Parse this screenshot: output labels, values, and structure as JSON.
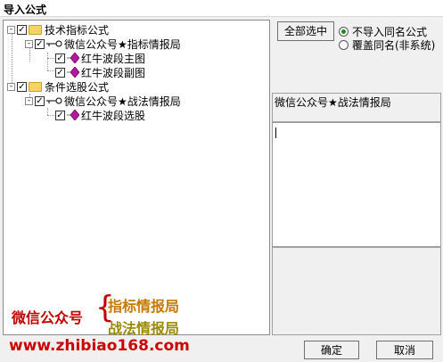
{
  "window": {
    "title": "导入公式"
  },
  "tree": {
    "groups": [
      {
        "label": "技术指标公式",
        "expander": "-",
        "children": [
          {
            "label": "微信公众号★指标情报局",
            "expander": "-",
            "items": [
              "红牛波段主图",
              "红牛波段副图"
            ]
          }
        ]
      },
      {
        "label": "条件选股公式",
        "expander": "-",
        "children": [
          {
            "label": "微信公众号★战法情报局",
            "expander": "-",
            "items": [
              "红牛波段选股"
            ]
          }
        ]
      }
    ],
    "checkmark": "✓"
  },
  "buttons": {
    "select_all": "全部选中",
    "ok": "确定",
    "cancel": "取消"
  },
  "options": [
    {
      "label": "不导入同名公式",
      "selected": true
    },
    {
      "label": "覆盖同名(非系统)",
      "selected": false
    }
  ],
  "info_label": "微信公众号★战法情报局",
  "watermark": {
    "left": "微信公众号",
    "brace": "{",
    "line1": "指标情报局",
    "line2": "战法情报局",
    "url": "www.zhibiao168.com"
  },
  "colors": {
    "radio_selected": "#1a8a1a",
    "watermark_red": "#c00000",
    "gem": "#b5179e"
  }
}
